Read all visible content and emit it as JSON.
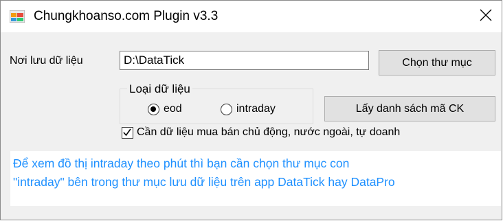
{
  "window": {
    "title": "Chungkhoanso.com Plugin v3.3",
    "icon": "app-window-icon"
  },
  "storage": {
    "label": "Nơi lưu dữ liệu",
    "path_value": "D:\\DataTick",
    "choose_folder_label": "Chọn thư mục"
  },
  "data_type": {
    "group_label": "Loại dữ liệu",
    "options": [
      {
        "label": "eod",
        "selected": true
      },
      {
        "label": "intraday",
        "selected": false
      }
    ]
  },
  "get_list_label": "Lấy danh sách mã CK",
  "need_data_checkbox": {
    "label": "Cần dữ liệu mua bán chủ động, nước ngoài, tự doanh",
    "checked": true
  },
  "info": {
    "lines": [
      "Để xem đồ thị intraday theo phút thì bạn cần chọn thư mục con",
      "\"intraday\" bên trong thư mục lưu dữ liệu trên app DataTick hay DataPro"
    ],
    "color": "#1e90ff"
  }
}
